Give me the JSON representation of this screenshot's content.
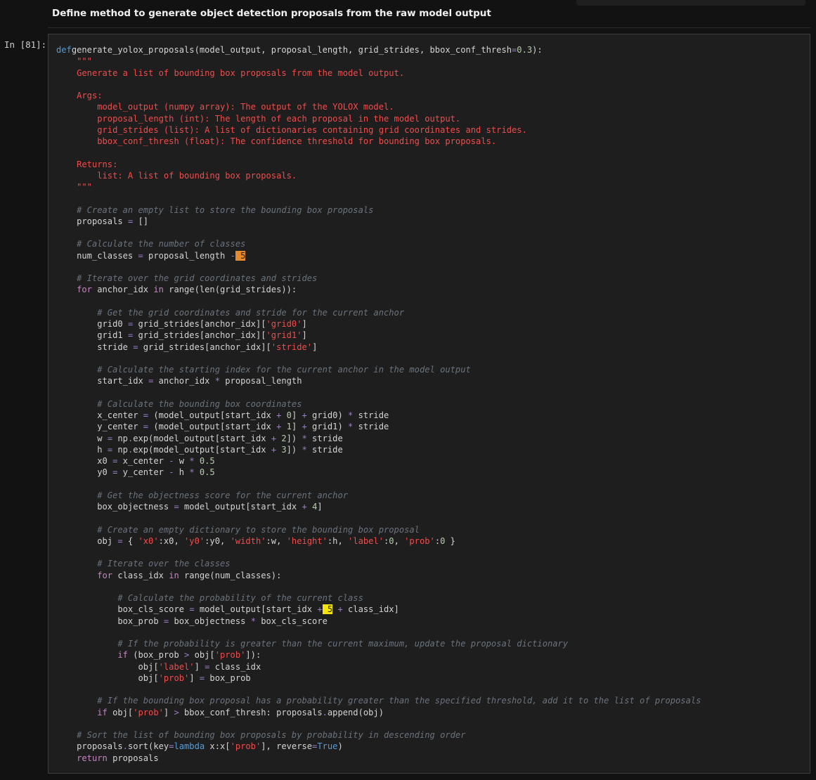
{
  "markdown": {
    "heading": "Define method to generate object detection proposals from the raw model output"
  },
  "cell": {
    "prompt": "In [81]:"
  },
  "code_lines": [
    [
      [
        "kw",
        "def"
      ],
      [
        "",
        ""
      ],
      [
        "",
        "generate_yolox_proposals(model_output, proposal_length, grid_strides, bbox_conf_thresh"
      ],
      [
        "op",
        "="
      ],
      [
        "num",
        "0.3"
      ],
      [
        "",
        "):"
      ]
    ],
    [
      [
        "doc",
        "    \"\"\""
      ]
    ],
    [
      [
        "doc",
        "    Generate a list of bounding box proposals from the model output."
      ]
    ],
    [
      [
        "",
        ""
      ]
    ],
    [
      [
        "doc",
        "    Args:"
      ]
    ],
    [
      [
        "doc",
        "        model_output (numpy array): The output of the YOLOX model."
      ]
    ],
    [
      [
        "doc",
        "        proposal_length (int): The length of each proposal in the model output."
      ]
    ],
    [
      [
        "doc",
        "        grid_strides (list): A list of dictionaries containing grid coordinates and strides."
      ]
    ],
    [
      [
        "doc",
        "        bbox_conf_thresh (float): The confidence threshold for bounding box proposals."
      ]
    ],
    [
      [
        "",
        ""
      ]
    ],
    [
      [
        "doc",
        "    Returns:"
      ]
    ],
    [
      [
        "doc",
        "        list: A list of bounding box proposals."
      ]
    ],
    [
      [
        "doc",
        "    \"\"\""
      ]
    ],
    [
      [
        "",
        ""
      ]
    ],
    [
      [
        "com",
        "    # Create an empty list to store the bounding box proposals"
      ]
    ],
    [
      [
        "",
        "    proposals "
      ],
      [
        "op",
        "="
      ],
      [
        "",
        " []"
      ]
    ],
    [
      [
        "",
        ""
      ]
    ],
    [
      [
        "com",
        "    # Calculate the number of classes"
      ]
    ],
    [
      [
        "",
        "    num_classes "
      ],
      [
        "op",
        "="
      ],
      [
        "",
        " proposal_length "
      ],
      [
        "op",
        "-"
      ],
      [
        "",
        ""
      ],
      [
        "hl-orange",
        " 5"
      ]
    ],
    [
      [
        "",
        ""
      ]
    ],
    [
      [
        "com",
        "    # Iterate over the grid coordinates and strides"
      ]
    ],
    [
      [
        "kw2",
        "    for"
      ],
      [
        "",
        " anchor_idx "
      ],
      [
        "kw2",
        "in"
      ],
      [
        "",
        " range(len(grid_strides)):"
      ]
    ],
    [
      [
        "",
        ""
      ]
    ],
    [
      [
        "com",
        "        # Get the grid coordinates and stride for the current anchor"
      ]
    ],
    [
      [
        "",
        "        grid0 "
      ],
      [
        "op",
        "="
      ],
      [
        "",
        " grid_strides[anchor_idx]["
      ],
      [
        "strs",
        "'grid0'"
      ],
      [
        "",
        "]"
      ]
    ],
    [
      [
        "",
        "        grid1 "
      ],
      [
        "op",
        "="
      ],
      [
        "",
        " grid_strides[anchor_idx]["
      ],
      [
        "strs",
        "'grid1'"
      ],
      [
        "",
        "]"
      ]
    ],
    [
      [
        "",
        "        stride "
      ],
      [
        "op",
        "="
      ],
      [
        "",
        " grid_strides[anchor_idx]["
      ],
      [
        "strs",
        "'stride'"
      ],
      [
        "",
        "]"
      ]
    ],
    [
      [
        "",
        ""
      ]
    ],
    [
      [
        "com",
        "        # Calculate the starting index for the current anchor in the model output"
      ]
    ],
    [
      [
        "",
        "        start_idx "
      ],
      [
        "op",
        "="
      ],
      [
        "",
        " anchor_idx "
      ],
      [
        "op",
        "*"
      ],
      [
        "",
        " proposal_length"
      ]
    ],
    [
      [
        "",
        ""
      ]
    ],
    [
      [
        "com",
        "        # Calculate the bounding box coordinates"
      ]
    ],
    [
      [
        "",
        "        x_center "
      ],
      [
        "op",
        "="
      ],
      [
        "",
        " (model_output[start_idx "
      ],
      [
        "op",
        "+"
      ],
      [
        "",
        " "
      ],
      [
        "num",
        "0"
      ],
      [
        "",
        "] "
      ],
      [
        "op",
        "+"
      ],
      [
        "",
        " grid0) "
      ],
      [
        "op",
        "*"
      ],
      [
        "",
        " stride"
      ]
    ],
    [
      [
        "",
        "        y_center "
      ],
      [
        "op",
        "="
      ],
      [
        "",
        " (model_output[start_idx "
      ],
      [
        "op",
        "+"
      ],
      [
        "",
        " "
      ],
      [
        "num",
        "1"
      ],
      [
        "",
        "] "
      ],
      [
        "op",
        "+"
      ],
      [
        "",
        " grid1) "
      ],
      [
        "op",
        "*"
      ],
      [
        "",
        " stride"
      ]
    ],
    [
      [
        "",
        "        w "
      ],
      [
        "op",
        "="
      ],
      [
        "",
        " np"
      ],
      [
        "op",
        "."
      ],
      [
        "",
        "exp(model_output[start_idx "
      ],
      [
        "op",
        "+"
      ],
      [
        "",
        " "
      ],
      [
        "num",
        "2"
      ],
      [
        "",
        "]) "
      ],
      [
        "op",
        "*"
      ],
      [
        "",
        " stride"
      ]
    ],
    [
      [
        "",
        "        h "
      ],
      [
        "op",
        "="
      ],
      [
        "",
        " np"
      ],
      [
        "op",
        "."
      ],
      [
        "",
        "exp(model_output[start_idx "
      ],
      [
        "op",
        "+"
      ],
      [
        "",
        " "
      ],
      [
        "num",
        "3"
      ],
      [
        "",
        "]) "
      ],
      [
        "op",
        "*"
      ],
      [
        "",
        " stride"
      ]
    ],
    [
      [
        "",
        "        x0 "
      ],
      [
        "op",
        "="
      ],
      [
        "",
        " x_center "
      ],
      [
        "op",
        "-"
      ],
      [
        "",
        " w "
      ],
      [
        "op",
        "*"
      ],
      [
        "",
        " "
      ],
      [
        "num",
        "0.5"
      ]
    ],
    [
      [
        "",
        "        y0 "
      ],
      [
        "op",
        "="
      ],
      [
        "",
        " y_center "
      ],
      [
        "op",
        "-"
      ],
      [
        "",
        " h "
      ],
      [
        "op",
        "*"
      ],
      [
        "",
        " "
      ],
      [
        "num",
        "0.5"
      ]
    ],
    [
      [
        "",
        ""
      ]
    ],
    [
      [
        "com",
        "        # Get the objectness score for the current anchor"
      ]
    ],
    [
      [
        "",
        "        box_objectness "
      ],
      [
        "op",
        "="
      ],
      [
        "",
        " model_output[start_idx "
      ],
      [
        "op",
        "+"
      ],
      [
        "",
        " "
      ],
      [
        "num",
        "4"
      ],
      [
        "",
        "]"
      ]
    ],
    [
      [
        "",
        ""
      ]
    ],
    [
      [
        "com",
        "        # Create an empty dictionary to store the bounding box proposal"
      ]
    ],
    [
      [
        "",
        "        obj "
      ],
      [
        "op",
        "="
      ],
      [
        "",
        " { "
      ],
      [
        "strs",
        "'x0'"
      ],
      [
        "",
        ":x0, "
      ],
      [
        "strs",
        "'y0'"
      ],
      [
        "",
        ":y0, "
      ],
      [
        "strs",
        "'width'"
      ],
      [
        "",
        ":w, "
      ],
      [
        "strs",
        "'height'"
      ],
      [
        "",
        ":h, "
      ],
      [
        "strs",
        "'label'"
      ],
      [
        "",
        ":"
      ],
      [
        "num",
        "0"
      ],
      [
        "",
        ", "
      ],
      [
        "strs",
        "'prob'"
      ],
      [
        "",
        ":"
      ],
      [
        "num",
        "0"
      ],
      [
        "",
        " }"
      ]
    ],
    [
      [
        "",
        ""
      ]
    ],
    [
      [
        "com",
        "        # Iterate over the classes"
      ]
    ],
    [
      [
        "kw2",
        "        for"
      ],
      [
        "",
        " class_idx "
      ],
      [
        "kw2",
        "in"
      ],
      [
        "",
        " range(num_classes):"
      ]
    ],
    [
      [
        "",
        ""
      ]
    ],
    [
      [
        "com",
        "            # Calculate the probability of the current class"
      ]
    ],
    [
      [
        "",
        "            box_cls_score "
      ],
      [
        "op",
        "="
      ],
      [
        "",
        " model_output[start_idx "
      ],
      [
        "op",
        "+"
      ],
      [
        "hl-yellow",
        " 5"
      ],
      [
        "",
        " "
      ],
      [
        "op",
        "+"
      ],
      [
        "",
        " class_idx]"
      ]
    ],
    [
      [
        "",
        "            box_prob "
      ],
      [
        "op",
        "="
      ],
      [
        "",
        " box_objectness "
      ],
      [
        "op",
        "*"
      ],
      [
        "",
        " box_cls_score"
      ]
    ],
    [
      [
        "",
        ""
      ]
    ],
    [
      [
        "com",
        "            # If the probability is greater than the current maximum, update the proposal dictionary"
      ]
    ],
    [
      [
        "kw2",
        "            if"
      ],
      [
        "",
        " (box_prob "
      ],
      [
        "op",
        ">"
      ],
      [
        "",
        " obj["
      ],
      [
        "strs",
        "'prob'"
      ],
      [
        "",
        "]):"
      ]
    ],
    [
      [
        "",
        "                obj["
      ],
      [
        "strs",
        "'label'"
      ],
      [
        "",
        "] "
      ],
      [
        "op",
        "="
      ],
      [
        "",
        " class_idx"
      ]
    ],
    [
      [
        "",
        "                obj["
      ],
      [
        "strs",
        "'prob'"
      ],
      [
        "",
        "] "
      ],
      [
        "op",
        "="
      ],
      [
        "",
        " box_prob"
      ]
    ],
    [
      [
        "",
        ""
      ]
    ],
    [
      [
        "com",
        "        # If the bounding box proposal has a probability greater than the specified threshold, add it to the list of proposals"
      ]
    ],
    [
      [
        "kw2",
        "        if"
      ],
      [
        "",
        " obj["
      ],
      [
        "strs",
        "'prob'"
      ],
      [
        "",
        "] "
      ],
      [
        "op",
        ">"
      ],
      [
        "",
        " bbox_conf_thresh: proposals"
      ],
      [
        "op",
        "."
      ],
      [
        "",
        "append(obj)"
      ]
    ],
    [
      [
        "",
        ""
      ]
    ],
    [
      [
        "com",
        "    # Sort the list of bounding box proposals by probability in descending order"
      ]
    ],
    [
      [
        "",
        "    proposals"
      ],
      [
        "op",
        "."
      ],
      [
        "",
        "sort(key"
      ],
      [
        "op",
        "="
      ],
      [
        "kw",
        "lambda"
      ],
      [
        "",
        " x:x["
      ],
      [
        "strs",
        "'prob'"
      ],
      [
        "",
        "], reverse"
      ],
      [
        "op",
        "="
      ],
      [
        "kw",
        "True"
      ],
      [
        "",
        ")"
      ]
    ],
    [
      [
        "kw2",
        "    return"
      ],
      [
        "",
        " proposals"
      ]
    ]
  ]
}
